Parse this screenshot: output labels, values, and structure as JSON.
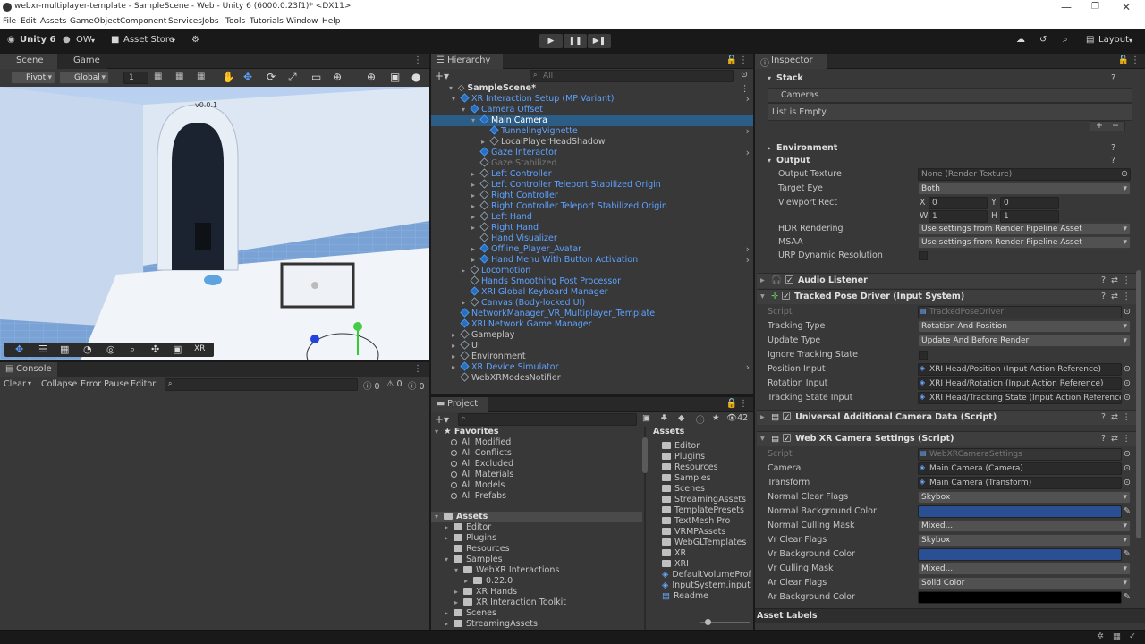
{
  "window": {
    "title": "webxr-multiplayer-template - SampleScene - Web - Unity 6 (6000.0.23f1)* <DX11>",
    "min": "—",
    "max": "❐",
    "close": "✕"
  },
  "menu": [
    "File",
    "Edit",
    "Assets",
    "GameObject",
    "Component",
    "Services",
    "Jobs",
    "Tools",
    "Tutorials",
    "Window",
    "Help"
  ],
  "toolbar": {
    "unity": "Unity 6",
    "account": "OW",
    "store": "Asset Store",
    "layout": "Layout"
  },
  "scene": {
    "tab_scene": "Scene",
    "tab_game": "Game",
    "pivot": "Pivot",
    "global": "Global",
    "snap": "1",
    "version_label": "v0.0.1",
    "xr_label": "XR"
  },
  "console": {
    "tab": "Console",
    "clear": "Clear",
    "collapse": "Collapse",
    "error_pause": "Error Pause",
    "editor": "Editor",
    "count_log": "0",
    "count_warn": "0",
    "count_err": "0"
  },
  "hierarchy": {
    "tab": "Hierarchy",
    "search": "All",
    "scene": "SampleScene*",
    "items": [
      {
        "label": "XR Interaction Setup (MP Variant)",
        "depth": 1,
        "color": "blue",
        "exp": "▾",
        "icon": "b"
      },
      {
        "label": "Camera Offset",
        "depth": 2,
        "color": "blue",
        "exp": "▾",
        "icon": "b"
      },
      {
        "label": "Main Camera",
        "depth": 3,
        "color": "white",
        "exp": "▾",
        "icon": "b",
        "selected": true
      },
      {
        "label": "TunnelingVignette",
        "depth": 4,
        "color": "blue",
        "exp": "",
        "icon": "b"
      },
      {
        "label": "LocalPlayerHeadShadow",
        "depth": 4,
        "color": "white",
        "exp": "▸",
        "icon": ""
      },
      {
        "label": "Gaze Interactor",
        "depth": 3,
        "color": "blue",
        "exp": "",
        "icon": "b"
      },
      {
        "label": "Gaze Stabilized",
        "depth": 3,
        "color": "gray",
        "exp": "",
        "icon": ""
      },
      {
        "label": "Left Controller",
        "depth": 3,
        "color": "blue",
        "exp": "▸",
        "icon": ""
      },
      {
        "label": "Left Controller Teleport Stabilized Origin",
        "depth": 3,
        "color": "blue",
        "exp": "▸",
        "icon": ""
      },
      {
        "label": "Right Controller",
        "depth": 3,
        "color": "blue",
        "exp": "▸",
        "icon": ""
      },
      {
        "label": "Right Controller Teleport Stabilized Origin",
        "depth": 3,
        "color": "blue",
        "exp": "▸",
        "icon": ""
      },
      {
        "label": "Left Hand",
        "depth": 3,
        "color": "blue",
        "exp": "▸",
        "icon": ""
      },
      {
        "label": "Right Hand",
        "depth": 3,
        "color": "blue",
        "exp": "▸",
        "icon": ""
      },
      {
        "label": "Hand Visualizer",
        "depth": 3,
        "color": "blue",
        "exp": "",
        "icon": ""
      },
      {
        "label": "Offline_Player_Avatar",
        "depth": 3,
        "color": "blue",
        "exp": "▸",
        "icon": "b"
      },
      {
        "label": "Hand Menu With Button Activation",
        "depth": 3,
        "color": "blue",
        "exp": "▸",
        "icon": "b"
      },
      {
        "label": "Locomotion",
        "depth": 2,
        "color": "blue",
        "exp": "▸",
        "icon": ""
      },
      {
        "label": "Hands Smoothing Post Processor",
        "depth": 2,
        "color": "blue",
        "exp": "",
        "icon": ""
      },
      {
        "label": "XRI Global Keyboard Manager",
        "depth": 2,
        "color": "blue",
        "exp": "",
        "icon": "b"
      },
      {
        "label": "Canvas (Body-locked UI)",
        "depth": 2,
        "color": "blue",
        "exp": "▸",
        "icon": ""
      },
      {
        "label": "NetworkManager_VR_Multiplayer_Template",
        "depth": 1,
        "color": "blue",
        "exp": "",
        "icon": "b"
      },
      {
        "label": "XRI Network Game Manager",
        "depth": 1,
        "color": "blue",
        "exp": "",
        "icon": "b"
      },
      {
        "label": "Gameplay",
        "depth": 1,
        "color": "white",
        "exp": "▸",
        "icon": ""
      },
      {
        "label": "UI",
        "depth": 1,
        "color": "white",
        "exp": "▸",
        "icon": ""
      },
      {
        "label": "Environment",
        "depth": 1,
        "color": "white",
        "exp": "▸",
        "icon": ""
      },
      {
        "label": "XR Device Simulator",
        "depth": 1,
        "color": "blue",
        "exp": "▸",
        "icon": "b"
      },
      {
        "label": "WebXRModesNotifier",
        "depth": 1,
        "color": "white",
        "exp": "",
        "icon": ""
      }
    ]
  },
  "project": {
    "tab": "Project",
    "count": "42",
    "favorites_label": "Favorites",
    "favorites": [
      "All Modified",
      "All Conflicts",
      "All Excluded",
      "All Materials",
      "All Models",
      "All Prefabs"
    ],
    "tree": [
      {
        "label": "Assets",
        "depth": 0,
        "exp": "▾",
        "bold": true
      },
      {
        "label": "Editor",
        "depth": 1,
        "exp": "▸"
      },
      {
        "label": "Plugins",
        "depth": 1,
        "exp": "▸"
      },
      {
        "label": "Resources",
        "depth": 1,
        "exp": ""
      },
      {
        "label": "Samples",
        "depth": 1,
        "exp": "▾"
      },
      {
        "label": "WebXR Interactions",
        "depth": 2,
        "exp": "▾"
      },
      {
        "label": "0.22.0",
        "depth": 3,
        "exp": "▸"
      },
      {
        "label": "XR Hands",
        "depth": 2,
        "exp": "▸"
      },
      {
        "label": "XR Interaction Toolkit",
        "depth": 2,
        "exp": "▸"
      },
      {
        "label": "Scenes",
        "depth": 1,
        "exp": "▸"
      },
      {
        "label": "StreamingAssets",
        "depth": 1,
        "exp": "▸"
      }
    ],
    "assets_header": "Assets",
    "assets": [
      "Editor",
      "Plugins",
      "Resources",
      "Samples",
      "Scenes",
      "StreamingAssets",
      "TemplatePresets",
      "TextMesh Pro",
      "VRMPAssets",
      "WebGLTemplates",
      "XR",
      "XRI",
      "DefaultVolumeProfile",
      "InputSystem.inputsettings",
      "Readme"
    ]
  },
  "inspector": {
    "tab": "Inspector",
    "stack": "Stack",
    "cameras": "Cameras",
    "list_empty": "List is Empty",
    "plus": "+",
    "minus": "−",
    "environment": "Environment",
    "output": "Output",
    "output_texture_l": "Output Texture",
    "output_texture_v": "None (Render Texture)",
    "target_eye_l": "Target Eye",
    "target_eye_v": "Both",
    "viewport_l": "Viewport Rect",
    "vx_l": "X",
    "vx": "0",
    "vy_l": "Y",
    "vy": "0",
    "vw_l": "W",
    "vw": "1",
    "vh_l": "H",
    "vh": "1",
    "hdr_l": "HDR Rendering",
    "hdr_v": "Use settings from Render Pipeline Asset",
    "msaa_l": "MSAA",
    "msaa_v": "Use settings from Render Pipeline Asset",
    "urp_l": "URP Dynamic Resolution",
    "audio": "Audio Listener",
    "tpd": "Tracked Pose Driver (Input System)",
    "tpd_fields": [
      {
        "l": "Script",
        "v": "TrackedPoseDriver",
        "kind": "script"
      },
      {
        "l": "Tracking Type",
        "v": "Rotation And Position",
        "kind": "drop"
      },
      {
        "l": "Update Type",
        "v": "Update And Before Render",
        "kind": "drop"
      },
      {
        "l": "Ignore Tracking State",
        "v": "",
        "kind": "check"
      },
      {
        "l": "Position Input",
        "v": "XRI Head/Position (Input Action Reference)",
        "kind": "ref"
      },
      {
        "l": "Rotation Input",
        "v": "XRI Head/Rotation (Input Action Reference)",
        "kind": "ref"
      },
      {
        "l": "Tracking State Input",
        "v": "XRI Head/Tracking State (Input Action Reference)",
        "kind": "ref"
      }
    ],
    "uacd": "Universal Additional Camera Data (Script)",
    "webxr": "Web XR Camera Settings (Script)",
    "webxr_fields": [
      {
        "l": "Script",
        "v": "WebXRCameraSettings",
        "kind": "script"
      },
      {
        "l": "Camera",
        "v": "Main Camera (Camera)",
        "kind": "ref"
      },
      {
        "l": "Transform",
        "v": "Main Camera (Transform)",
        "kind": "ref"
      },
      {
        "l": "Normal Clear Flags",
        "v": "Skybox",
        "kind": "drop"
      },
      {
        "l": "Normal Background Color",
        "v": "",
        "kind": "color",
        "c": "#2a4f93"
      },
      {
        "l": "Normal Culling Mask",
        "v": "Mixed...",
        "kind": "drop"
      },
      {
        "l": "Vr Clear Flags",
        "v": "Skybox",
        "kind": "drop"
      },
      {
        "l": "Vr Background Color",
        "v": "",
        "kind": "color",
        "c": "#2a4f93"
      },
      {
        "l": "Vr Culling Mask",
        "v": "Mixed...",
        "kind": "drop"
      },
      {
        "l": "Ar Clear Flags",
        "v": "Solid Color",
        "kind": "drop"
      },
      {
        "l": "Ar Background Color",
        "v": "",
        "kind": "color",
        "c": "#000000"
      }
    ],
    "asset_labels": "Asset Labels"
  }
}
